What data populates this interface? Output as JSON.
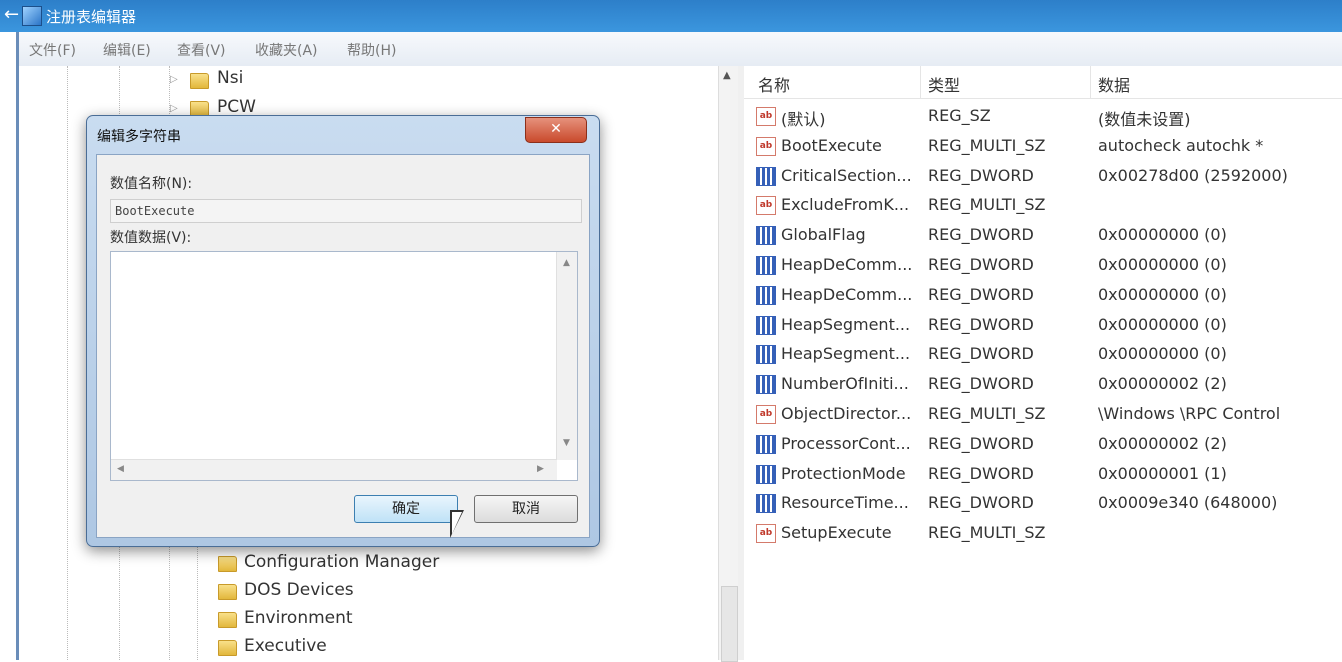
{
  "window": {
    "title": "注册表编辑器",
    "back_glyph": "←"
  },
  "menu": [
    "文件(F)",
    "编辑(E)",
    "查看(V)",
    "收藏夹(A)",
    "帮助(H)"
  ],
  "tree": {
    "top_items": [
      "Nsi",
      "PCW"
    ],
    "bottom_items": [
      "Configuration Manager",
      "DOS Devices",
      "Environment",
      "Executive"
    ]
  },
  "columns": {
    "name": "名称",
    "type": "类型",
    "data": "数据"
  },
  "values": [
    {
      "icon": "string-value-icon",
      "name": "(默认)",
      "type": "REG_SZ",
      "data": "(数值未设置)"
    },
    {
      "icon": "string-value-icon",
      "name": "BootExecute",
      "type": "REG_MULTI_SZ",
      "data": "autocheck autochk *"
    },
    {
      "icon": "binary-value-icon",
      "name": "CriticalSection...",
      "type": "REG_DWORD",
      "data": "0x00278d00 (2592000)"
    },
    {
      "icon": "string-value-icon",
      "name": "ExcludeFromK...",
      "type": "REG_MULTI_SZ",
      "data": ""
    },
    {
      "icon": "binary-value-icon",
      "name": "GlobalFlag",
      "type": "REG_DWORD",
      "data": "0x00000000 (0)"
    },
    {
      "icon": "binary-value-icon",
      "name": "HeapDeComm...",
      "type": "REG_DWORD",
      "data": "0x00000000 (0)"
    },
    {
      "icon": "binary-value-icon",
      "name": "HeapDeComm...",
      "type": "REG_DWORD",
      "data": "0x00000000 (0)"
    },
    {
      "icon": "binary-value-icon",
      "name": "HeapSegment...",
      "type": "REG_DWORD",
      "data": "0x00000000 (0)"
    },
    {
      "icon": "binary-value-icon",
      "name": "HeapSegment...",
      "type": "REG_DWORD",
      "data": "0x00000000 (0)"
    },
    {
      "icon": "binary-value-icon",
      "name": "NumberOfIniti...",
      "type": "REG_DWORD",
      "data": "0x00000002 (2)"
    },
    {
      "icon": "string-value-icon",
      "name": "ObjectDirector...",
      "type": "REG_MULTI_SZ",
      "data": "\\Windows \\RPC Control"
    },
    {
      "icon": "binary-value-icon",
      "name": "ProcessorCont...",
      "type": "REG_DWORD",
      "data": "0x00000002 (2)"
    },
    {
      "icon": "binary-value-icon",
      "name": "ProtectionMode",
      "type": "REG_DWORD",
      "data": "0x00000001 (1)"
    },
    {
      "icon": "binary-value-icon",
      "name": "ResourceTime...",
      "type": "REG_DWORD",
      "data": "0x0009e340 (648000)"
    },
    {
      "icon": "string-value-icon",
      "name": "SetupExecute",
      "type": "REG_MULTI_SZ",
      "data": ""
    }
  ],
  "dialog": {
    "title": "编辑多字符串",
    "close_glyph": "✕",
    "name_label": "数值名称(N):",
    "name_value": "BootExecute",
    "data_label": "数值数据(V):",
    "data_value": "",
    "ok_label": "确定",
    "cancel_label": "取消"
  }
}
